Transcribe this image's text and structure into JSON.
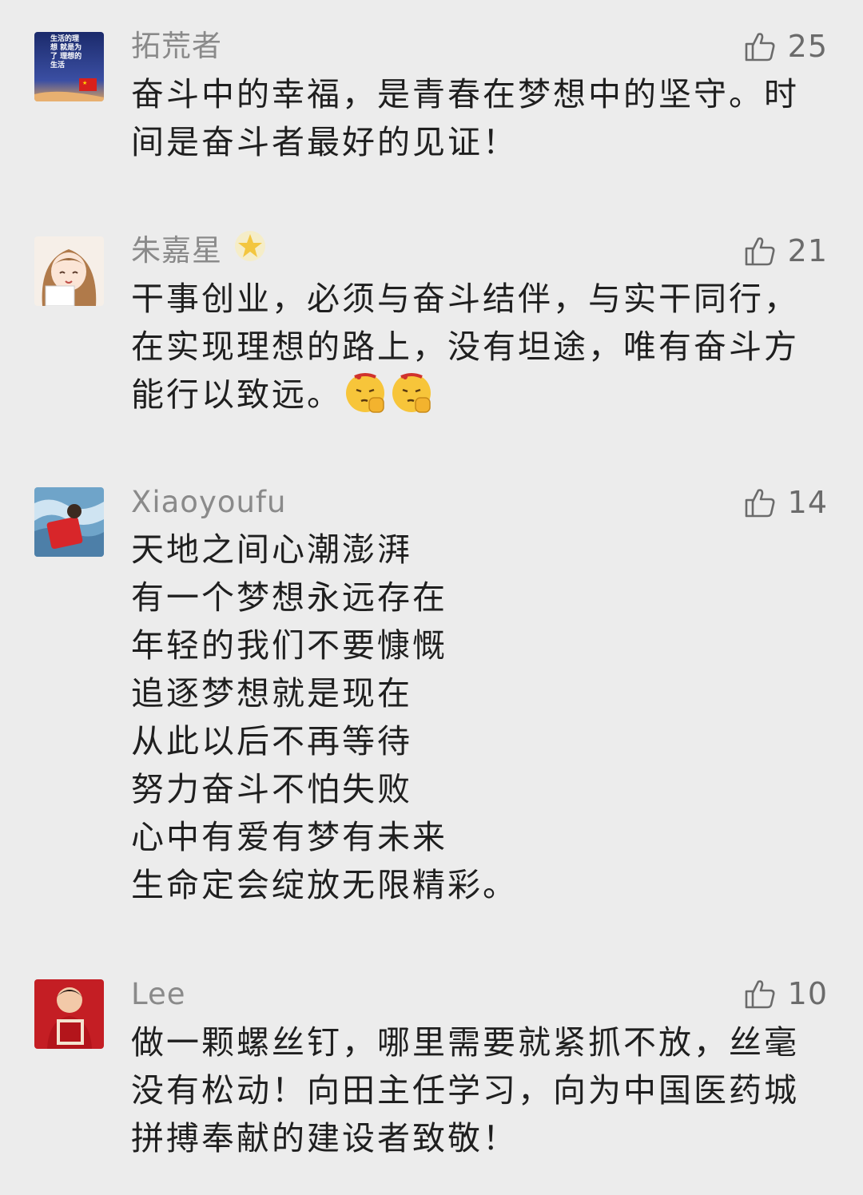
{
  "comments": [
    {
      "nickname": "拓荒者",
      "likes": "25",
      "avatar_text": "生活的理想 就是为了 理想的生活",
      "lines": [
        "奋斗中的幸福，是青春在梦想中的坚守。时",
        "间是奋斗者最好的见证！"
      ]
    },
    {
      "nickname": "朱嘉星",
      "likes": "21",
      "badge": "star-badge-icon",
      "lines": [
        "干事创业，必须与奋斗结伴，与实干同行，",
        "在实现理想的路上，没有坦途，唯有奋斗方",
        "能行以致远。"
      ],
      "emojis": [
        "fist-emoji",
        "fist-emoji"
      ]
    },
    {
      "nickname": "Xiaoyoufu",
      "likes": "14",
      "lines": [
        "天地之间心潮澎湃",
        "有一个梦想永远存在",
        "年轻的我们不要慷慨",
        "追逐梦想就是现在",
        "从此以后不再等待",
        "努力奋斗不怕失败",
        "心中有爱有梦有未来",
        "生命定会绽放无限精彩。"
      ]
    },
    {
      "nickname": "Lee",
      "likes": "10",
      "lines": [
        "做一颗螺丝钉，哪里需要就紧抓不放，丝毫",
        "没有松动！向田主任学习，向为中国医药城",
        "拼搏奉献的建设者致敬！"
      ]
    }
  ],
  "colors": {
    "background": "#ececec",
    "nickname": "#8a8a8a",
    "text": "#1f1f1f",
    "like": "#6b6b6b"
  }
}
